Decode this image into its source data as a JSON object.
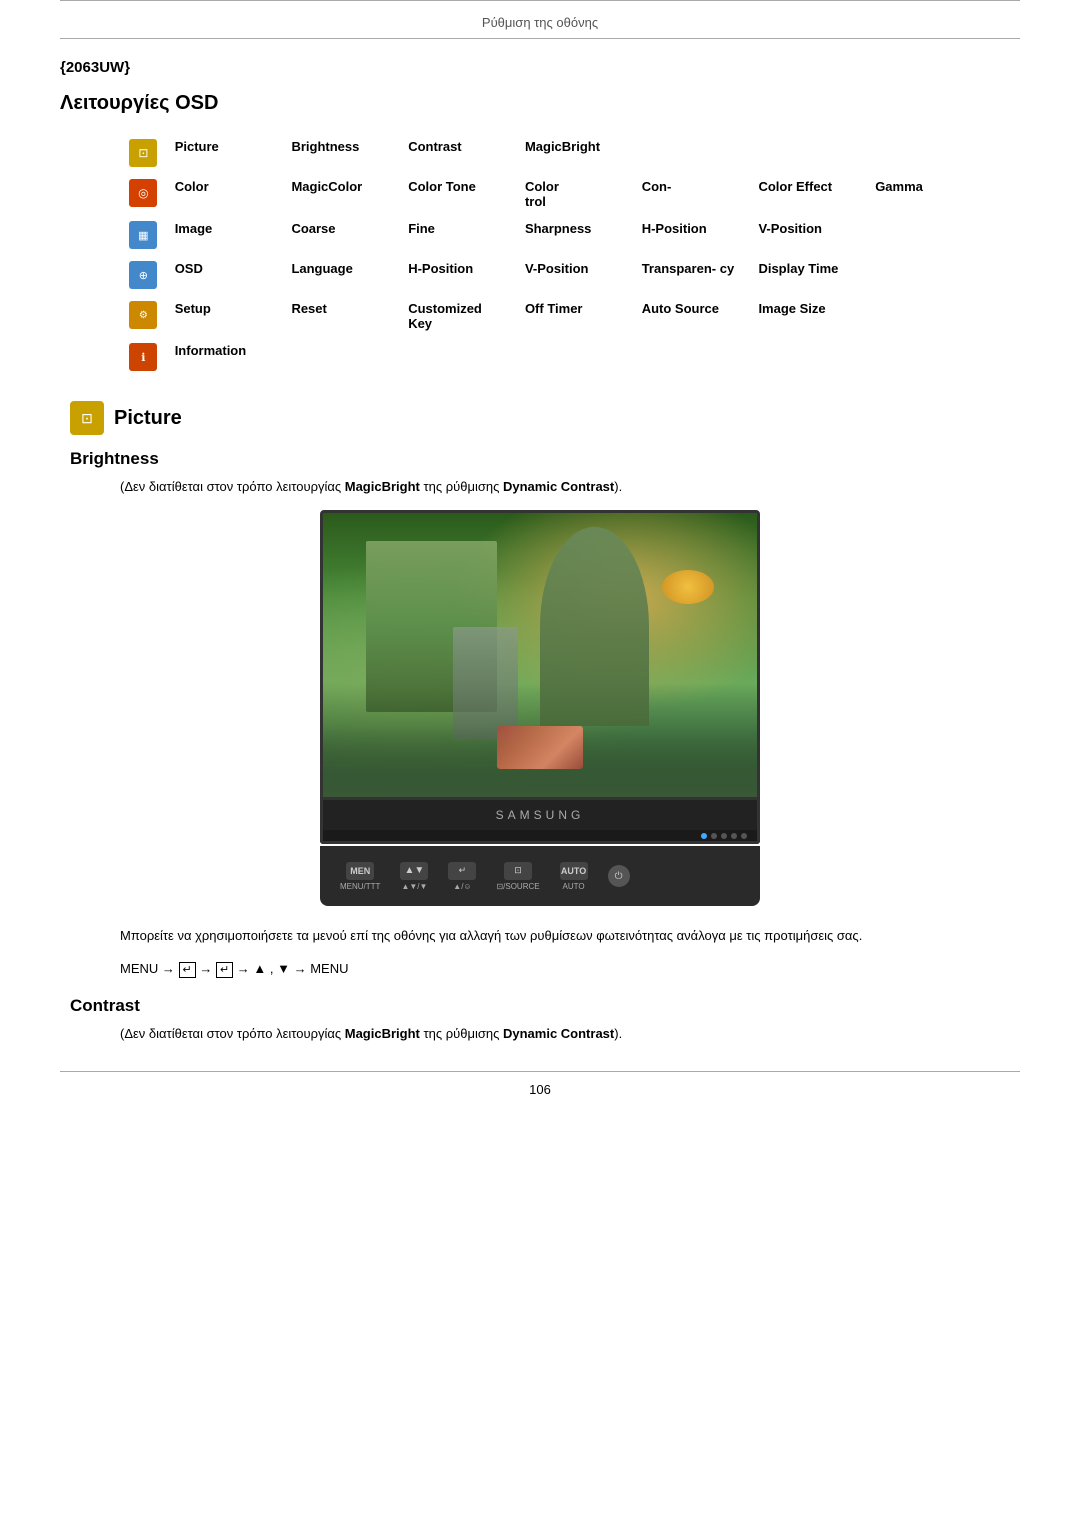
{
  "page": {
    "header_title": "Ρύθμιση της οθόνης",
    "model_number": "{2063UW}",
    "section_greek": "Λειτουργίες OSD",
    "page_number": "106"
  },
  "osd_table": {
    "rows": [
      {
        "icon": "picture",
        "label": "Picture",
        "cols": [
          "Brightness",
          "Contrast",
          "MagicBright",
          "",
          ""
        ]
      },
      {
        "icon": "color",
        "label": "Color",
        "cols": [
          "MagicColor",
          "Color Tone",
          "Color trol",
          "Con-",
          "Color Effect",
          "Gamma"
        ]
      },
      {
        "icon": "image",
        "label": "Image",
        "cols": [
          "Coarse",
          "Fine",
          "Sharpness",
          "H-Position",
          "V-Position"
        ]
      },
      {
        "icon": "osd",
        "label": "OSD",
        "cols": [
          "Language",
          "H-Position",
          "V-Position",
          "Transparen- cy",
          "Display Time"
        ]
      },
      {
        "icon": "setup",
        "label": "Setup",
        "cols": [
          "Reset",
          "Customized Key",
          "Off Timer",
          "Auto Source",
          "Image Size"
        ]
      },
      {
        "icon": "info",
        "label": "Information",
        "cols": []
      }
    ]
  },
  "picture_section": {
    "title": "Picture",
    "brightness_title": "Brightness",
    "brightness_note": "(Δεν διατίθεται στον τρόπο λειτουργίας MagicBright της ρύθμισης Dynamic Contrast).",
    "brightness_note_bold1": "MagicBright",
    "brightness_note_bold2": "Dynamic Contrast",
    "monitor_brand": "SAMSUNG",
    "body_text": "Μπορείτε να χρησιμοποιήσετε τα μενού επί της οθόνης για αλλαγή των ρυθμίσεων φωτεινότητας ανάλογα με τις προτιμήσεις σας.",
    "menu_path": "MENU → ↵ → ↵ → ▲, ▼ → MENU",
    "contrast_title": "Contrast",
    "contrast_note": "(Δεν διατίθεται στον τρόπο λειτουργίας MagicBright της ρύθμισης Dynamic Contrast).",
    "contrast_note_bold1": "MagicBright",
    "contrast_note_bold2": "Dynamic Contrast"
  },
  "controls": {
    "menu": "MENU/TTT",
    "arrows": "▲▼/▼",
    "enter": "▲/☺",
    "source": "⊡/SOURCE",
    "auto": "AUTO",
    "power": "⏻"
  }
}
